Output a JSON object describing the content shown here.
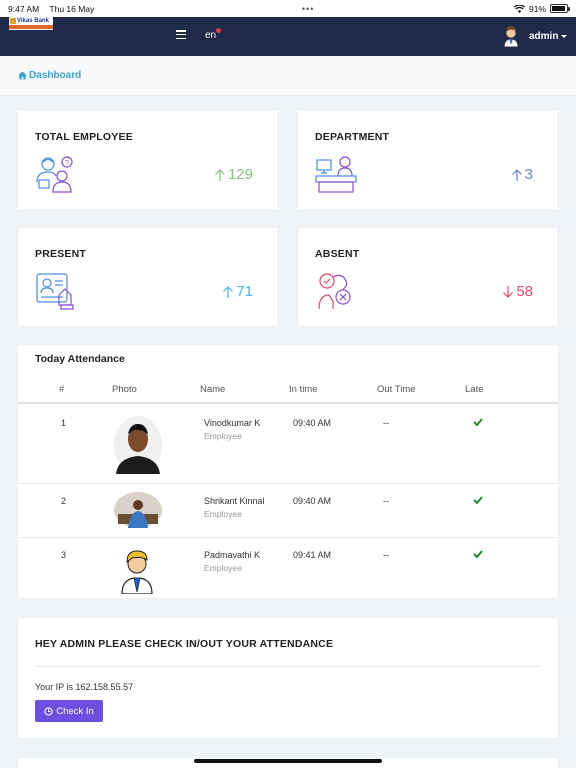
{
  "statusbar": {
    "time": "9:47 AM",
    "date": "Thu 16 May",
    "battery": "91%",
    "battery_level": 0.91
  },
  "navbar": {
    "logo_text": "Vikas Bank",
    "language": "en",
    "user": "admin"
  },
  "breadcrumb": {
    "label": "Dashboard"
  },
  "stats": {
    "total_employee": {
      "title": "TOTAL EMPLOYEE",
      "value": "129",
      "trend": "up",
      "color": "#7cc576"
    },
    "department": {
      "title": "DEPARTMENT",
      "value": "3",
      "trend": "up",
      "color": "#6f7fd1"
    },
    "present": {
      "title": "PRESENT",
      "value": "71",
      "trend": "up",
      "color": "#3fb8e3"
    },
    "absent": {
      "title": "ABSENT",
      "value": "58",
      "trend": "down",
      "color": "#e04a6a"
    }
  },
  "attendance": {
    "title": "Today Attendance",
    "columns": [
      "#",
      "Photo",
      "Name",
      "In time",
      "Out Time",
      "Late"
    ],
    "rows": [
      {
        "num": "1",
        "name": "Vinodkumar K",
        "role": "Employee",
        "in_time": "09:40 AM",
        "out_time": "--"
      },
      {
        "num": "2",
        "name": "Shrikant Kinnal",
        "role": "Employee",
        "in_time": "09:40 AM",
        "out_time": "--"
      },
      {
        "num": "3",
        "name": "Padmavathi K",
        "role": "Employee",
        "in_time": "09:41 AM",
        "out_time": "--"
      }
    ]
  },
  "checkin": {
    "title": "HEY ADMIN PLEASE CHECK IN/OUT YOUR ATTENDANCE",
    "ip_text": "Your IP is 162.158.55.57",
    "button": "Check In"
  }
}
